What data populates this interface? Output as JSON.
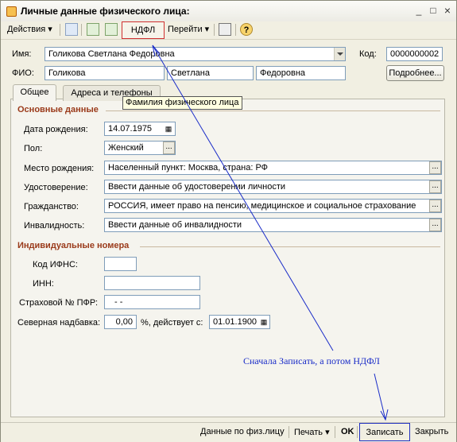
{
  "window": {
    "title": "Личные данные физического лица:",
    "controls": {
      "minimize": "_",
      "maximize": "□",
      "close": "×"
    }
  },
  "toolbar": {
    "actions_label": "Действия",
    "ndfl_label": "НДФЛ",
    "goto_label": "Перейти",
    "help_label": "?"
  },
  "header": {
    "name_label": "Имя:",
    "name_value": "Голикова Светлана Федоровна",
    "code_label": "Код:",
    "code_value": "0000000002",
    "fio_label": "ФИО:",
    "last_name": "Голикова",
    "first_name": "Светлана",
    "middle_name": "Федоровна",
    "more_button": "Подробнее..."
  },
  "tabs": {
    "general": "Общее",
    "addresses": "Адреса и телефоны"
  },
  "tooltip": "Фамилия физического лица",
  "basic": {
    "section": "Основные данные",
    "birth_date_label": "Дата рождения:",
    "birth_date_value": "14.07.1975",
    "gender_label": "Пол:",
    "gender_value": "Женский",
    "birthplace_label": "Место рождения:",
    "birthplace_value": "Населенный пункт: Москва, страна: РФ",
    "id_label": "Удостоверение:",
    "id_value": "Ввести данные об удостоверении личности",
    "citizenship_label": "Гражданство:",
    "citizenship_value": "РОССИЯ, имеет право на пенсию, медицинское и социальное страхование",
    "disability_label": "Инвалидность:",
    "disability_value": "Ввести данные об инвалидности"
  },
  "numbers": {
    "section": "Индивидуальные номера",
    "ifns_label": "Код ИФНС:",
    "ifns_value": "",
    "inn_label": "ИНН:",
    "inn_value": "",
    "pfr_label": "Страховой № ПФР:",
    "pfr_value": "-   -",
    "north_label": "Северная надбавка:",
    "north_value": "0,00",
    "percent_label": "%, действует с:",
    "north_date": "01.01.1900"
  },
  "statusbar": {
    "person_data": "Данные по физ.лицу",
    "print": "Печать",
    "ok": "OK",
    "save": "Записать",
    "close": "Закрыть"
  },
  "annotation": "Сначала Записать, а потом  НДФЛ",
  "colors": {
    "annotation": "#1a2cc8",
    "ndfl_highlight": "#d03030",
    "save_highlight": "#2030c0",
    "section_title": "#9a3a1a"
  }
}
